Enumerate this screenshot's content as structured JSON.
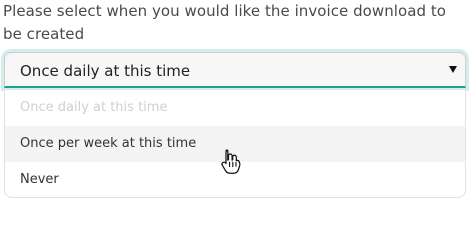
{
  "prompt": {
    "text": "Please select when you would like the invoice download to be created"
  },
  "select": {
    "selected_label": "Once daily at this time",
    "caret_icon": "caret-down-icon",
    "accent_color": "#1d9f93"
  },
  "dropdown": {
    "options": [
      {
        "label": "Once daily at this time",
        "state": "disabled"
      },
      {
        "label": "Once per week at this time",
        "state": "hover"
      },
      {
        "label": "Never",
        "state": "normal"
      }
    ]
  },
  "pointer": {
    "icon": "hand-pointer-icon"
  }
}
